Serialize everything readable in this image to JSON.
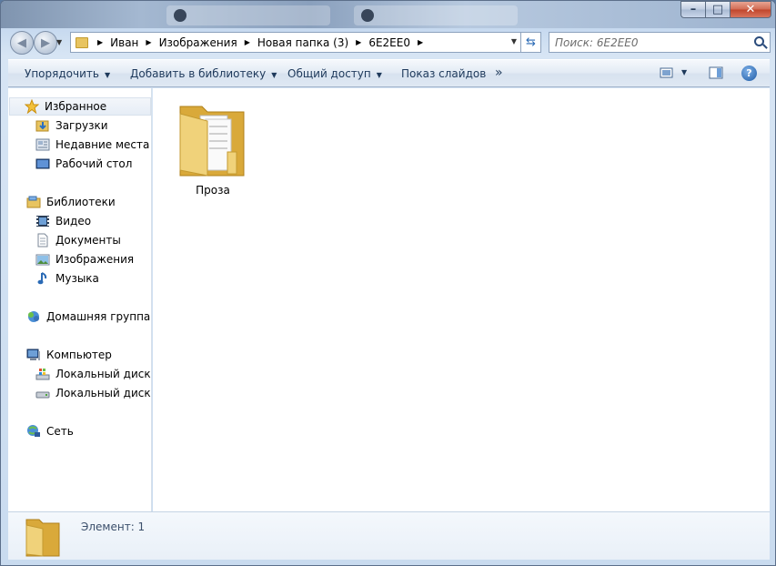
{
  "window": {
    "background_tabs": [
      "",
      ""
    ],
    "controls": {
      "minimize": "–",
      "maximize": "□",
      "close": "✕"
    }
  },
  "navigation": {
    "back_icon": "back-arrow-icon",
    "forward_icon": "forward-arrow-icon",
    "breadcrumbs": [
      "Иван",
      "Изображения",
      "Новая папка (3)",
      "6E2EE0"
    ],
    "search_placeholder": "Поиск: 6E2EE0"
  },
  "toolbar": {
    "organize": "Упорядочить",
    "add_to_library": "Добавить в библиотеку",
    "share": "Общий доступ",
    "slideshow": "Показ слайдов",
    "more": "»",
    "help": "?"
  },
  "sidebar": {
    "favorites": {
      "label": "Избранное",
      "items": [
        "Загрузки",
        "Недавние места",
        "Рабочий стол"
      ]
    },
    "libraries": {
      "label": "Библиотеки",
      "items": [
        "Видео",
        "Документы",
        "Изображения",
        "Музыка"
      ]
    },
    "homegroup": {
      "label": "Домашняя группа"
    },
    "computer": {
      "label": "Компьютер",
      "items": [
        "Локальный диск (C",
        "Локальный диск (D"
      ]
    },
    "network": {
      "label": "Сеть"
    }
  },
  "content": {
    "items": [
      {
        "name": "Проза",
        "type": "folder"
      }
    ]
  },
  "details": {
    "text": "Элемент: 1"
  },
  "colors": {
    "folder_yellow": "#e8c460",
    "command_text": "#1e395b",
    "accent": "#2a6ab5"
  }
}
